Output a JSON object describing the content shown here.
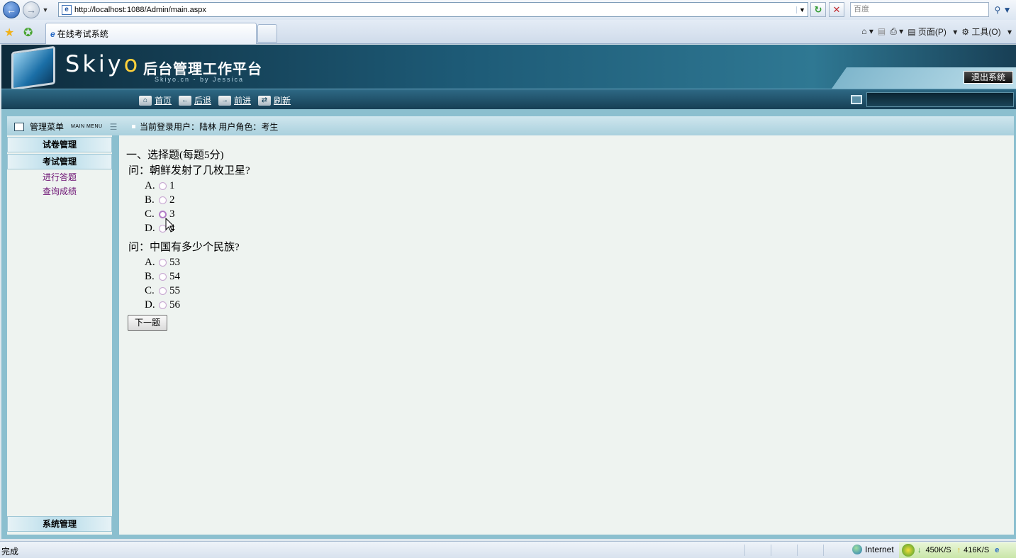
{
  "browser": {
    "url": "http://localhost:1088/Admin/main.aspx",
    "search_placeholder": "百度",
    "tab_title": "在线考试系统",
    "cmd_page": "页面(P)",
    "cmd_tools": "工具(O)"
  },
  "header": {
    "logo": "Skiy",
    "logo_o": "o",
    "platform": "后台管理工作平台",
    "sub": "Skiyo.cn - by Jessica",
    "logout": "退出系统"
  },
  "toolbar": {
    "home": "首页",
    "back": "后退",
    "forward": "前进",
    "refresh": "刷新"
  },
  "menu": {
    "title": "管理菜单",
    "title_en": "MAIN MENU",
    "groups": [
      "试卷管理",
      "考试管理",
      "系统管理"
    ],
    "links": [
      "进行答题",
      "查询成绩"
    ]
  },
  "login": {
    "text": "当前登录用户：陆林   用户角色：考生"
  },
  "exam": {
    "section_title": "一、选择题(每题5分)",
    "questions": [
      {
        "text": "问：朝鲜发射了几枚卫星?",
        "options": [
          {
            "letter": "A.",
            "value": "1"
          },
          {
            "letter": "B.",
            "value": "2"
          },
          {
            "letter": "C.",
            "value": "3"
          },
          {
            "letter": "D.",
            "value": "4"
          }
        ]
      },
      {
        "text": "问：中国有多少个民族?",
        "options": [
          {
            "letter": "A.",
            "value": "53"
          },
          {
            "letter": "B.",
            "value": "54"
          },
          {
            "letter": "C.",
            "value": "55"
          },
          {
            "letter": "D.",
            "value": "56"
          }
        ]
      }
    ],
    "next_button": "下一题"
  },
  "status": {
    "text": "完成",
    "zone": "Internet",
    "down_speed": "450K/S",
    "up_speed": "416K/S"
  }
}
